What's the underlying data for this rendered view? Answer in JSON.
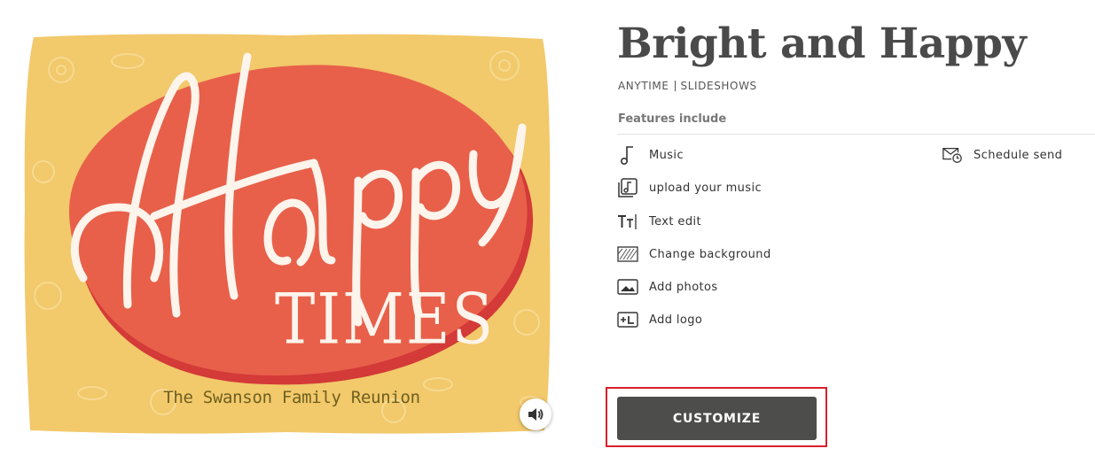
{
  "card": {
    "headline_script": "Happy",
    "headline_block": "TIMES",
    "subtitle": "The Swanson Family Reunion"
  },
  "product": {
    "title": "Bright and Happy",
    "tag1": "ANYTIME",
    "tag2": "SLIDESHOWS",
    "features_heading": "Features include"
  },
  "features": [
    {
      "label": "Music",
      "icon": "music-note-icon"
    },
    {
      "label": "upload your music",
      "icon": "upload-music-icon"
    },
    {
      "label": "Text edit",
      "icon": "text-edit-icon"
    },
    {
      "label": "Change background",
      "icon": "background-icon"
    },
    {
      "label": "Add photos",
      "icon": "photo-icon"
    },
    {
      "label": "Add logo",
      "icon": "logo-icon"
    },
    {
      "label": "Schedule send",
      "icon": "schedule-send-icon"
    }
  ],
  "actions": {
    "customize_label": "CUSTOMIZE"
  },
  "colors": {
    "card_background": "#f2c96b",
    "card_blob": "#e8604a",
    "button": "#4d4d4b",
    "highlight": "#d9202a"
  }
}
